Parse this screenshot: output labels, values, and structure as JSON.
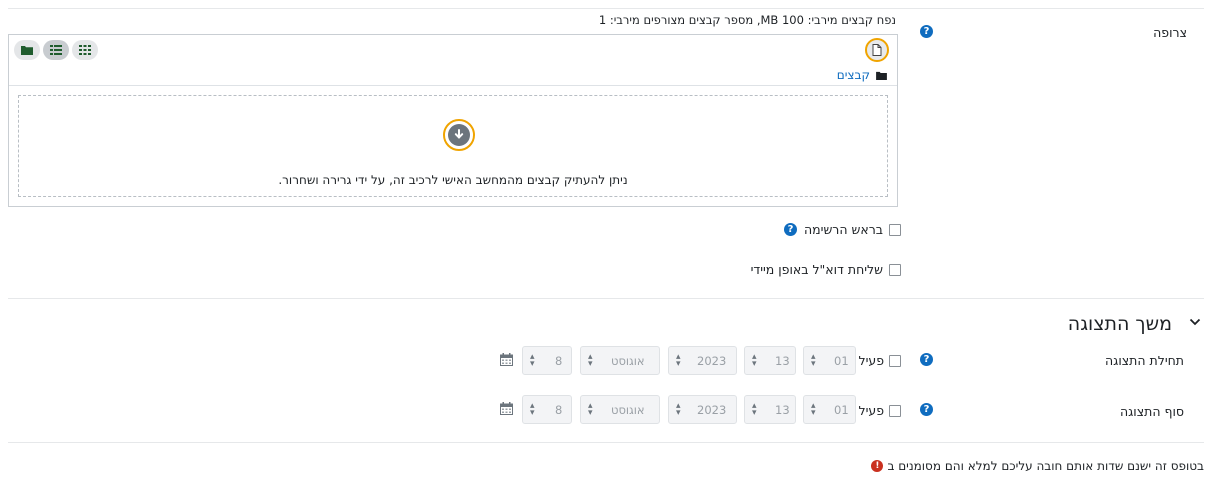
{
  "attachment": {
    "label": "צרופה",
    "limits_text": "נפח קבצים מירבי: 100 MB, מספר קבצים מצורפים מירבי: 1",
    "path_label": "קבצים",
    "drop_text": "ניתן להעתיק קבצים מהמחשב האישי לרכיב זה, על ידי גרירה ושחרור."
  },
  "options": {
    "pinned_label": "בראש הרשימה",
    "mail_now_label": "שליחת דוא\"ל באופן מיידי"
  },
  "display_period": {
    "title": "משך התצוגה",
    "start": {
      "label": "תחילת התצוגה",
      "enable_label": "פעיל",
      "day": "01",
      "month": "13",
      "year": "2023",
      "month_name": "אוגוסט",
      "hour": "8"
    },
    "end": {
      "label": "סוף התצוגה",
      "enable_label": "פעיל",
      "day": "01",
      "month": "13",
      "year": "2023",
      "month_name": "אוגוסט",
      "hour": "8"
    }
  },
  "footer": {
    "required_note": "בטופס זה ישנם שדות אותם חובה עליכם למלא והם מסומנים ב"
  },
  "icons": {
    "help": "help-icon",
    "add_file": "file-add-icon",
    "folder": "folder-icon",
    "download": "download-icon",
    "calendar": "calendar-icon",
    "required": "required-icon"
  },
  "colors": {
    "accent": "#0f6cbf",
    "highlight": "#f0a400",
    "required": "#ca3120",
    "folder": "#1f5c2e"
  }
}
